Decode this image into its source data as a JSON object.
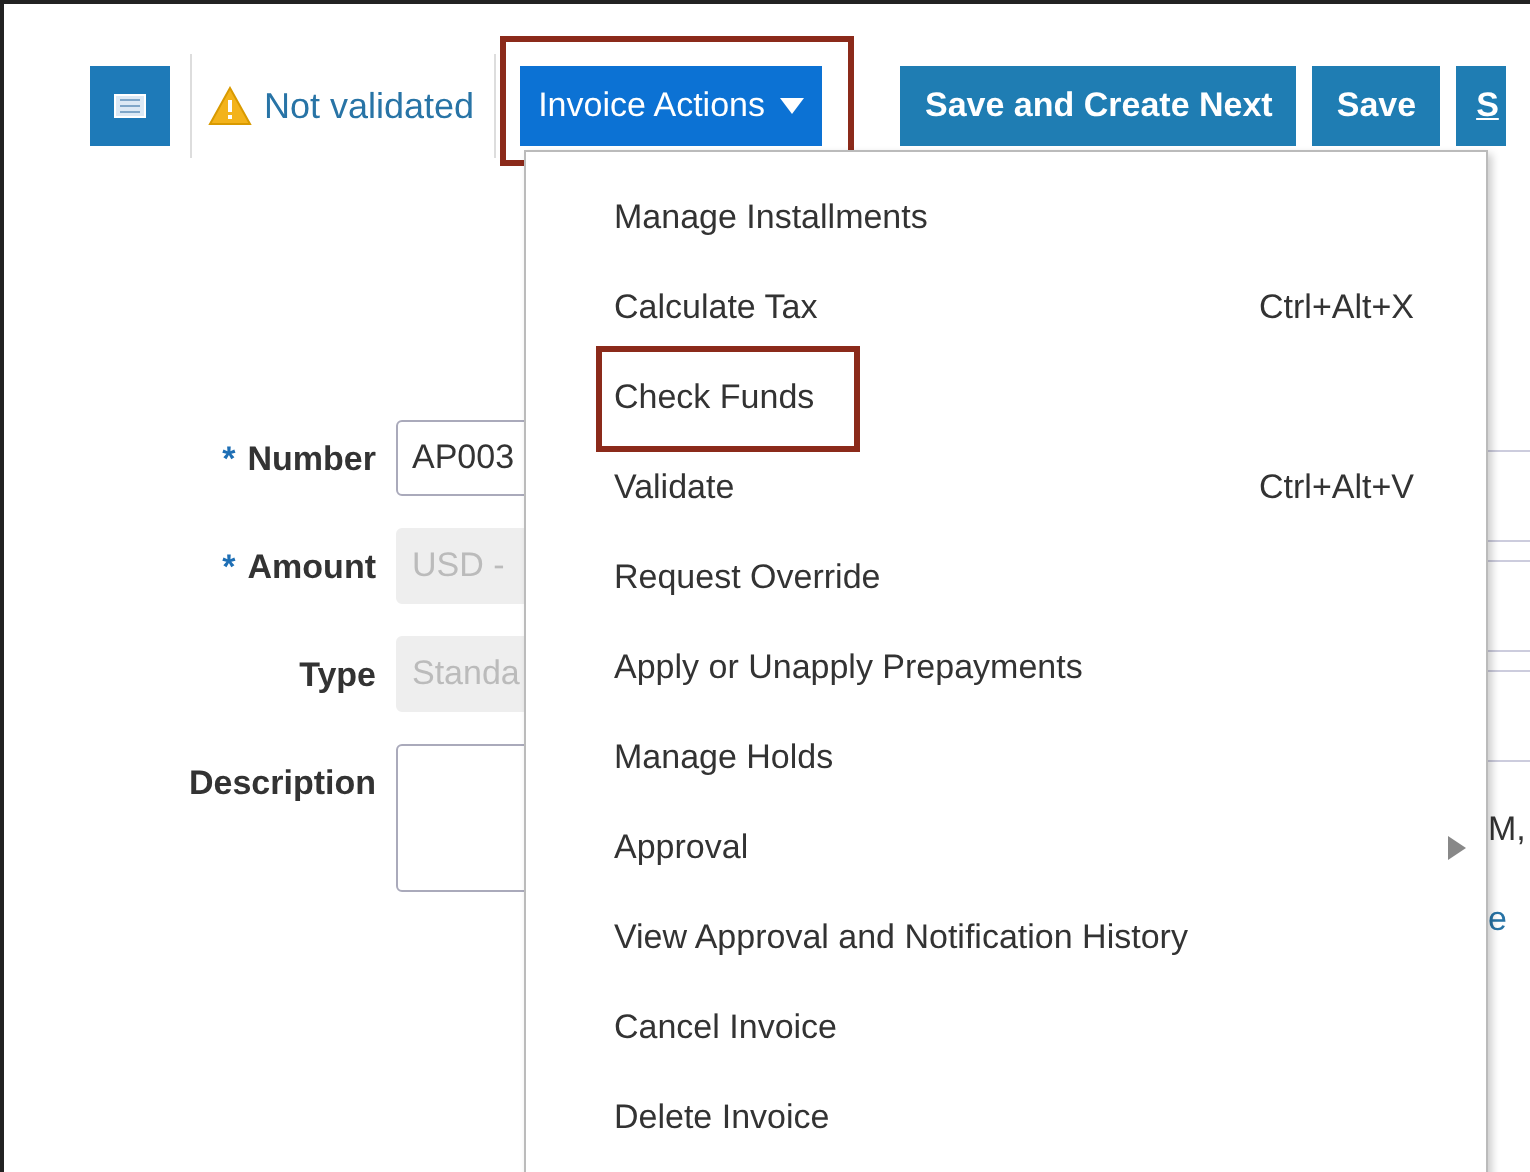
{
  "toolbar": {
    "status": {
      "label": "Not validated"
    },
    "actions_button": {
      "label": "Invoice Actions",
      "expanded": true,
      "annotated": true
    },
    "buttons": [
      {
        "label": "Save and Create Next"
      },
      {
        "label": "Save"
      },
      {
        "label": "S"
      }
    ]
  },
  "form": {
    "fields": [
      {
        "label": "Number",
        "required_mark": "*",
        "value": "AP003",
        "disabled": false,
        "kind": "text"
      },
      {
        "label": "Amount",
        "required_mark": "*",
        "value": "USD -",
        "disabled": true,
        "kind": "text"
      },
      {
        "label": "Type",
        "value": "Standa",
        "disabled": true,
        "kind": "text"
      },
      {
        "label": "Description",
        "disabled": false,
        "kind": "textarea"
      }
    ]
  },
  "right_panel": {
    "texts": [
      {
        "text": "M,",
        "kind": "text"
      },
      {
        "text": "e",
        "kind": "link"
      }
    ]
  },
  "menu": {
    "items": [
      {
        "label": "Manage Installments",
        "kind": "plain"
      },
      {
        "label": "Calculate Tax",
        "kind": "shortcut",
        "shortcut": "Ctrl+Alt+X"
      },
      {
        "label": "Check Funds",
        "kind": "plain",
        "annotated": true
      },
      {
        "label": "Validate",
        "kind": "shortcut",
        "shortcut": "Ctrl+Alt+V"
      },
      {
        "label": "Request Override",
        "kind": "plain"
      },
      {
        "label": "Apply or Unapply Prepayments",
        "kind": "plain"
      },
      {
        "label": "Manage Holds",
        "kind": "plain"
      },
      {
        "label": "Approval",
        "kind": "submenu"
      },
      {
        "label": "View Approval and Notification History",
        "kind": "plain"
      },
      {
        "label": "Cancel Invoice",
        "kind": "plain"
      },
      {
        "label": "Delete Invoice",
        "kind": "plain"
      }
    ]
  }
}
